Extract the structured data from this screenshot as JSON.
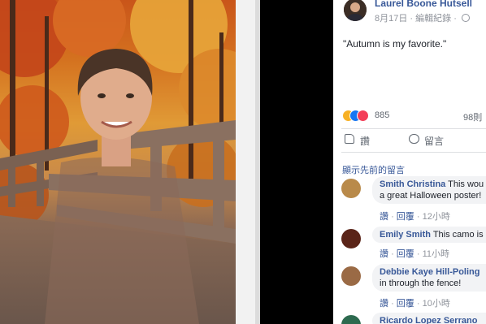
{
  "post": {
    "author": "Laurel Boone Hutsell",
    "date": "8月17日",
    "edit_history": "編輯紀錄",
    "text": "\"Autumn is my favorite.\"",
    "reaction_count": "885",
    "comment_count": "98則",
    "reaction_icons": [
      "haha-icon",
      "like-icon",
      "love-icon"
    ]
  },
  "actions": {
    "like": "讚",
    "comment": "留言"
  },
  "comments_section": {
    "view_previous": "顯示先前的留言"
  },
  "comments": [
    {
      "name": "Smith Christina",
      "text_line1": "This wou",
      "text_line2": "a great Halloween poster!",
      "like": "讚",
      "reply": "回覆",
      "time": "12小時"
    },
    {
      "name": "Emily Smith",
      "text_line1": "This camo is",
      "like": "讚",
      "reply": "回覆",
      "time": "11小時"
    },
    {
      "name": "Debbie Kaye Hill-Poling",
      "text_line2": "in through the fence!",
      "like": "讚",
      "reply": "回覆",
      "time": "10小時"
    },
    {
      "name": "Ricardo Lopez Serrano"
    }
  ],
  "colors": {
    "link_blue": "#385898",
    "text_dark": "#1d2129",
    "meta_gray": "#90949c",
    "background": "#000000"
  }
}
